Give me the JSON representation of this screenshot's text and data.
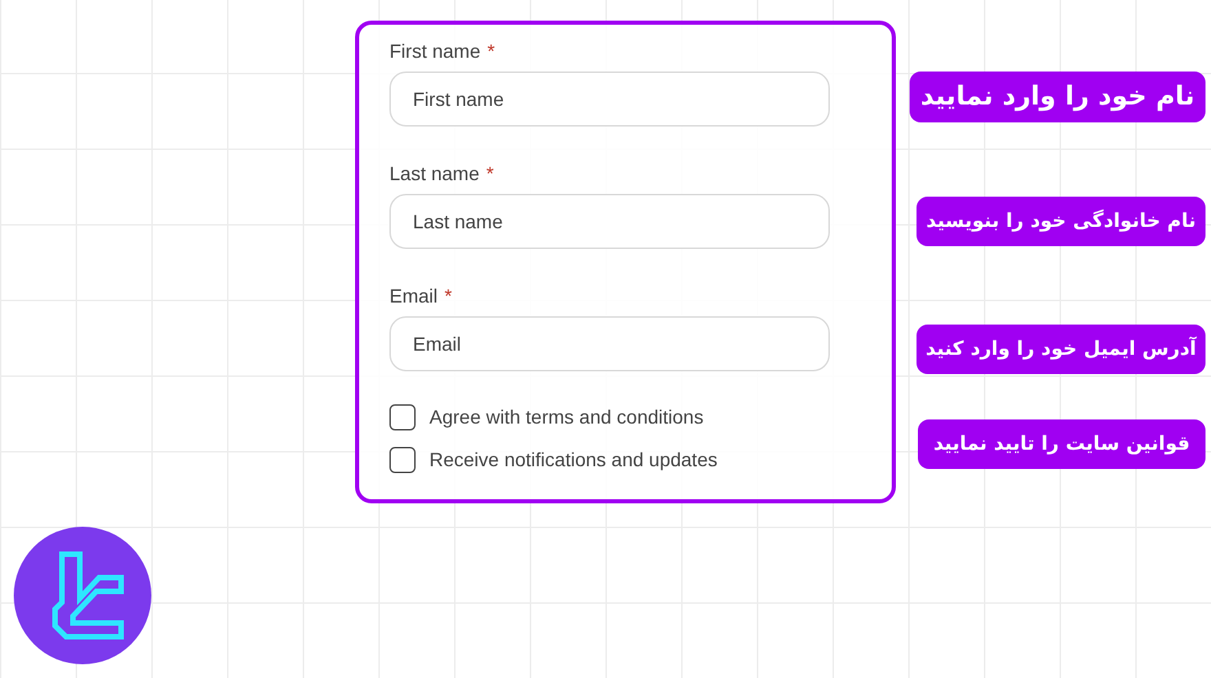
{
  "form": {
    "fields": [
      {
        "label": "First name",
        "required_mark": "*",
        "placeholder": "First name"
      },
      {
        "label": "Last name",
        "required_mark": "*",
        "placeholder": "Last name"
      },
      {
        "label": "Email",
        "required_mark": "*",
        "placeholder": "Email"
      }
    ],
    "checkboxes": [
      {
        "label": "Agree with terms and conditions",
        "checked": false
      },
      {
        "label": "Receive notifications and updates",
        "checked": false
      }
    ]
  },
  "annotations": [
    {
      "text": "نام خود را وارد نمایید"
    },
    {
      "text": "نام خانوادگی خود را بنویسید"
    },
    {
      "text": "آدرس ایمیل خود را وارد کنید"
    },
    {
      "text": "قوانین سایت را تایید نمایید"
    }
  ]
}
